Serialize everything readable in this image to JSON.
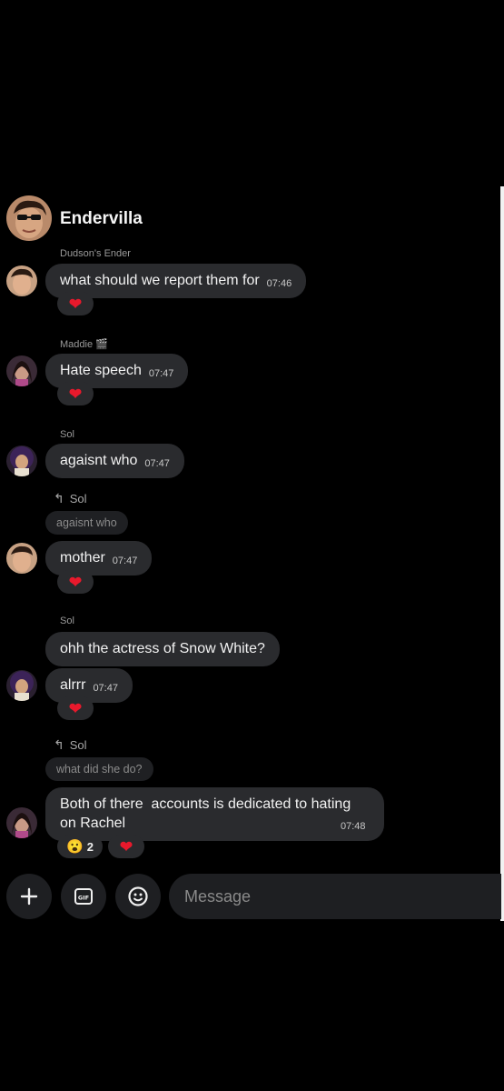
{
  "header": {
    "title": "Endervilla"
  },
  "messages": [
    {
      "sender": "Dudson's Ender",
      "text": "what should we report them for",
      "time": "07:46",
      "reaction": "heart"
    },
    {
      "sender": "Maddie 🎬",
      "text": "Hate speech",
      "time": "07:47",
      "reaction": "heart"
    },
    {
      "sender": "Sol",
      "text": "agaisnt who",
      "time": "07:47"
    },
    {
      "reply_to": "Sol",
      "quote": "agaisnt who",
      "text": "mother",
      "time": "07:47",
      "reaction": "heart"
    },
    {
      "sender": "Sol",
      "text": "ohh the actress of Snow White?"
    },
    {
      "text": "alrrr",
      "time": "07:47",
      "reaction": "heart"
    },
    {
      "reply_to": "Sol",
      "quote": "what did she do?",
      "text_line1": "Both of there  accounts is dedicated to hating",
      "text_line2": "on Rachel",
      "time": "07:48",
      "reactions": [
        {
          "emoji": "😮",
          "count": "2"
        },
        {
          "emoji": "heart"
        }
      ]
    }
  ],
  "composer": {
    "placeholder": "Message",
    "icons": [
      "plus-icon",
      "gif-icon",
      "emoji-icon"
    ]
  },
  "colors": {
    "background": "#000000",
    "bubble": "#2a2b2e",
    "heart": "#e8192c"
  }
}
